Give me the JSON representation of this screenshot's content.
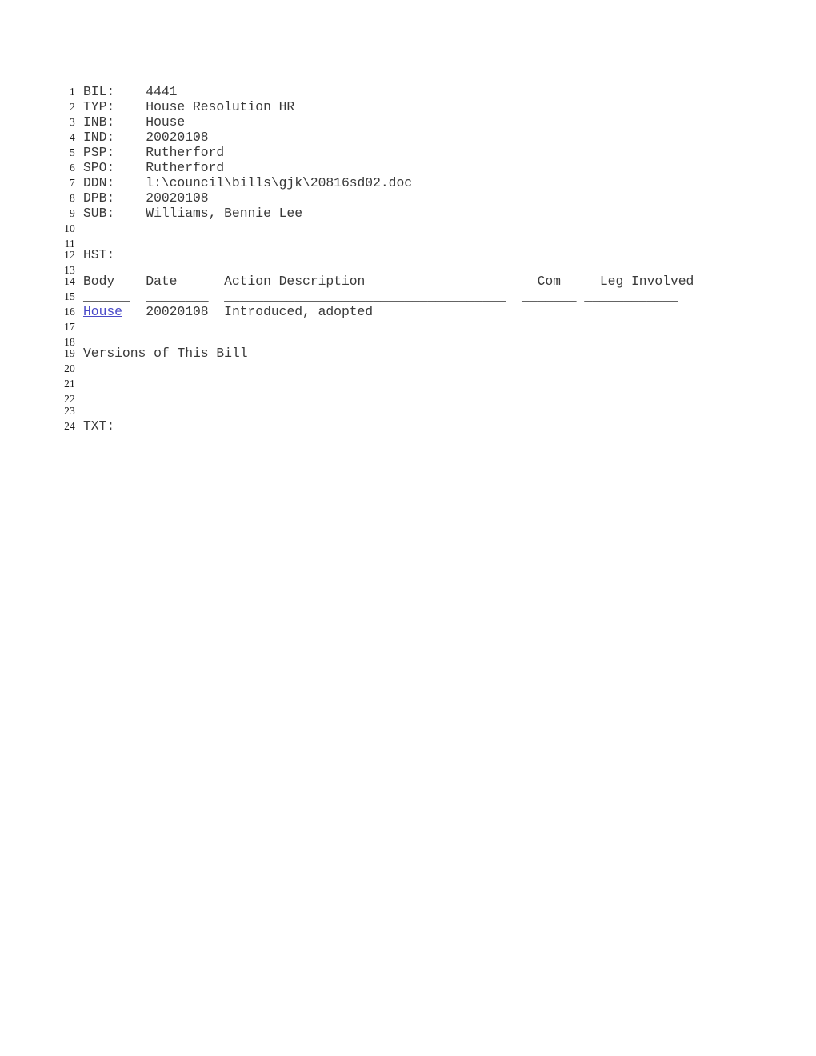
{
  "document": {
    "type": "legislative-bill-record",
    "bill_number": "4441",
    "page_background": "#ffffff",
    "text_color": "#3a3a3a",
    "line_number_color": "#1a1a1a",
    "link_color": "#4a4ac8"
  },
  "fields": {
    "bil_label": "BIL:",
    "bil_value": "4441",
    "typ_label": "TYP:",
    "typ_value": "House Resolution HR",
    "inb_label": "INB:",
    "inb_value": "House",
    "ind_label": "IND:",
    "ind_value": "20020108",
    "psp_label": "PSP:",
    "psp_value": "Rutherford",
    "spo_label": "SPO:",
    "spo_value": "Rutherford",
    "ddn_label": "DDN:",
    "ddn_value": "l:\\council\\bills\\gjk\\20816sd02.doc",
    "dpb_label": "DPB:",
    "dpb_value": "20020108",
    "sub_label": "SUB:",
    "sub_value": "Williams, Bennie Lee",
    "hst_label": "HST:",
    "txt_label": "TXT:"
  },
  "history_table": {
    "headers": [
      "Body",
      "Date",
      "Action Description",
      "Com",
      "Leg Involved"
    ],
    "rules": [
      "______",
      "________",
      "____________________________________",
      "_______",
      "____________"
    ],
    "rows": [
      {
        "body": "House",
        "body_is_link": true,
        "date": "20020108",
        "action_description": "Introduced, adopted",
        "com": "",
        "leg_involved": ""
      }
    ]
  },
  "versions_section": {
    "heading": "Versions of This Bill"
  },
  "lines": [
    {
      "n": "1",
      "text": "BIL:    4441"
    },
    {
      "n": "2",
      "text": "TYP:    House Resolution HR"
    },
    {
      "n": "3",
      "text": "INB:    House"
    },
    {
      "n": "4",
      "text": "IND:    20020108"
    },
    {
      "n": "5",
      "text": "PSP:    Rutherford"
    },
    {
      "n": "6",
      "text": "SPO:    Rutherford"
    },
    {
      "n": "7",
      "text": "DDN:    l:\\council\\bills\\gjk\\20816sd02.doc"
    },
    {
      "n": "8",
      "text": "DPB:    20020108"
    },
    {
      "n": "9",
      "text": "SUB:    Williams, Bennie Lee"
    },
    {
      "n": "10",
      "text": ""
    },
    {
      "n": "11",
      "text": ""
    },
    {
      "n": "12",
      "text": "HST:"
    },
    {
      "n": "13",
      "text": ""
    },
    {
      "n": "14",
      "text": "Body    Date      Action Description                      Com     Leg Involved"
    },
    {
      "n": "15",
      "text": "______  ________  ____________________________________  _______ ____________"
    },
    {
      "n": "16",
      "text": "House   20020108  Introduced, adopted"
    },
    {
      "n": "17",
      "text": ""
    },
    {
      "n": "18",
      "text": ""
    },
    {
      "n": "19",
      "text": "Versions of This Bill"
    },
    {
      "n": "20",
      "text": ""
    },
    {
      "n": "21",
      "text": ""
    },
    {
      "n": "22",
      "text": ""
    },
    {
      "n": "23",
      "text": ""
    },
    {
      "n": "24",
      "text": "TXT:"
    }
  ]
}
